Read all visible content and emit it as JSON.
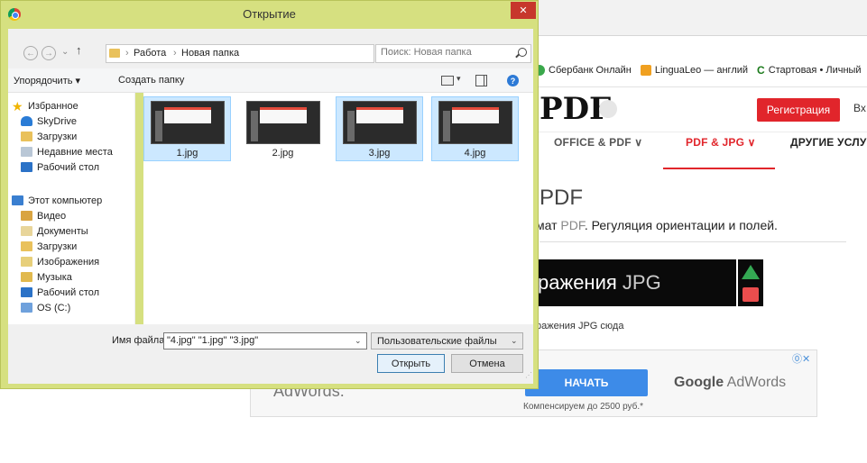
{
  "dialog": {
    "title": "Открытие",
    "close_label": "✕"
  },
  "address": {
    "path": [
      "Работа",
      "Новая папка"
    ],
    "search_placeholder": "Поиск: Новая папка"
  },
  "toolbar": {
    "organize": "Упорядочить ▾",
    "new_folder": "Создать папку"
  },
  "nav_pane": {
    "items": [
      {
        "label": "Избранное",
        "icon": "star-icon"
      },
      {
        "label": "SkyDrive",
        "icon": "cloud-icon"
      },
      {
        "label": "Загрузки",
        "icon": "downloads-icon"
      },
      {
        "label": "Недавние места",
        "icon": "recent-places-icon"
      },
      {
        "label": "Рабочий стол",
        "icon": "desktop-icon"
      },
      {
        "label": "Этот компьютер",
        "icon": "computer-icon"
      },
      {
        "label": "Видео",
        "icon": "video-icon"
      },
      {
        "label": "Документы",
        "icon": "documents-icon"
      },
      {
        "label": "Загрузки",
        "icon": "downloads-icon"
      },
      {
        "label": "Изображения",
        "icon": "images-icon"
      },
      {
        "label": "Музыка",
        "icon": "music-icon"
      },
      {
        "label": "Рабочий стол",
        "icon": "desktop-icon"
      },
      {
        "label": "OS (C:)",
        "icon": "drive-icon"
      }
    ]
  },
  "files": [
    {
      "name": "1.jpg",
      "selected": true
    },
    {
      "name": "2.jpg",
      "selected": false
    },
    {
      "name": "3.jpg",
      "selected": true
    },
    {
      "name": "4.jpg",
      "selected": true
    }
  ],
  "bottom": {
    "filename_label": "Имя файла:",
    "filename_value": "\"4.jpg\" \"1.jpg\" \"3.jpg\"",
    "filetype": "Пользовательские файлы",
    "open_button": "Открыть",
    "cancel_button": "Отмена"
  },
  "browser": {
    "bookmarks": [
      "Сбербанк Онлайн",
      "LinguaLeo — англий",
      "Стартовая • Личный"
    ],
    "logo": "PDF",
    "register": "Регистрация",
    "login": "Вх",
    "nav": [
      "OFFICE & PDF ∨",
      "PDF & JPG ∨",
      "ДРУГИЕ УСЛУ"
    ],
    "title": "PDF",
    "subtitle_grey_prefix": "мат",
    "subtitle_grey": "PDF",
    "subtitle_rest": ". Регуляция ориентации и полей.",
    "banner_text": "ражения",
    "banner_thin": "JPG",
    "drop_hint": "ражения JPG сюда",
    "ad_left": "AdWords.",
    "ad_button": "НАЧАТЬ",
    "ad_compensation": "Компенсируем до 2500 руб.*",
    "ad_google": "Google",
    "ad_adwords": "AdWords",
    "ad_icons": "⓪✕"
  }
}
